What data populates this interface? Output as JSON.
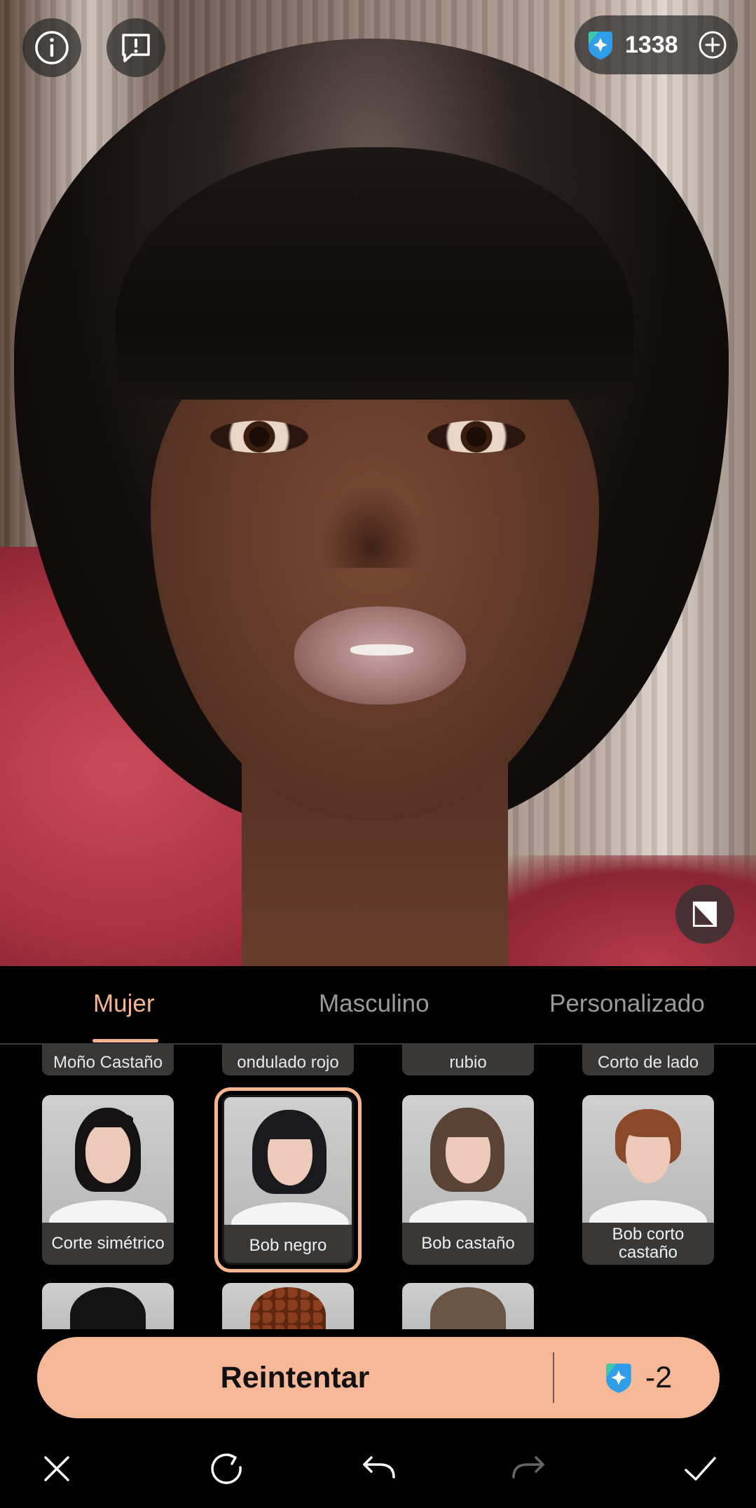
{
  "header": {
    "info_icon": "info-icon",
    "report_icon": "report-icon",
    "credits": "1338",
    "gem_icon": "gem-icon",
    "add_icon": "plus-icon"
  },
  "photo": {
    "compare_icon": "compare-icon"
  },
  "tabs": [
    {
      "label": "Mujer",
      "active": true
    },
    {
      "label": "Masculino",
      "active": false
    },
    {
      "label": "Personalizado",
      "active": false
    }
  ],
  "styles": {
    "top_row": [
      "Moño Castaño",
      "ondulado rojo",
      "rubio",
      "Corto de lado"
    ],
    "cards": [
      {
        "label": "Corte simétrico",
        "selected": false
      },
      {
        "label": "Bob negro",
        "selected": true
      },
      {
        "label": "Bob castaño",
        "selected": false
      },
      {
        "label": "Bob corto castaño",
        "selected": false
      }
    ]
  },
  "retry": {
    "label": "Reintentar",
    "cost": "-2"
  },
  "toolbar": [
    "close-icon",
    "refresh-icon",
    "undo-icon",
    "redo-icon",
    "check-icon"
  ],
  "colors": {
    "accent": "#f7b68f",
    "retry_bg": "#f7b898",
    "tab_inactive": "#9a9a9a"
  }
}
